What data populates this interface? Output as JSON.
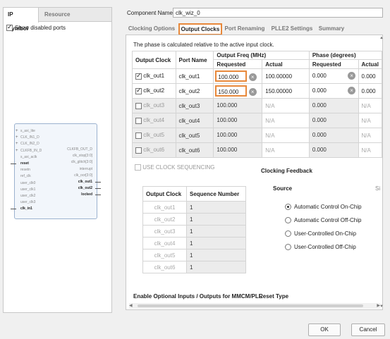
{
  "left_panel": {
    "tabs": [
      "IP Symbol",
      "Resource"
    ],
    "show_disabled_label": "Show disabled ports",
    "left_pins": [
      {
        "name": "s_axi_lite",
        "plus": true,
        "disabled": true
      },
      {
        "name": "CLK_IN1_D",
        "plus": true,
        "disabled": true
      },
      {
        "name": "CLK_IN2_D",
        "plus": true,
        "disabled": true
      },
      {
        "name": "CLKFB_IN_D",
        "plus": true,
        "disabled": true
      },
      {
        "name": "s_axi_aclk",
        "plus": false,
        "disabled": true
      },
      {
        "name": "reset",
        "plus": false,
        "disabled": false
      },
      {
        "name": "resetn",
        "plus": false,
        "disabled": true
      },
      {
        "name": "ref_clk",
        "plus": false,
        "disabled": true
      },
      {
        "name": "user_clk0",
        "plus": false,
        "disabled": true
      },
      {
        "name": "user_clk1",
        "plus": false,
        "disabled": true
      },
      {
        "name": "user_clk2",
        "plus": false,
        "disabled": true
      },
      {
        "name": "user_clk3",
        "plus": false,
        "disabled": true
      },
      {
        "name": "clk_in1",
        "plus": false,
        "disabled": false
      }
    ],
    "left_pins_extra": "s_axi_aresetn",
    "right_pins": [
      {
        "name": "CLKFB_OUT_D",
        "disabled": true
      },
      {
        "name": "clk_stop[3:0]",
        "disabled": true
      },
      {
        "name": "clk_glitch[3:0]",
        "disabled": true
      },
      {
        "name": "interrupt",
        "disabled": true
      },
      {
        "name": "clk_oor[3:0]",
        "disabled": true
      },
      {
        "name": "clk_out1",
        "disabled": false
      },
      {
        "name": "clk_out2",
        "disabled": false
      },
      {
        "name": "locked",
        "disabled": false
      }
    ]
  },
  "component": {
    "label": "Component Name",
    "value": "clk_wiz_0"
  },
  "tabs": [
    "Clocking Options",
    "Output Clocks",
    "Port Renaming",
    "PLLE2 Settings",
    "Summary"
  ],
  "active_tab": "Output Clocks",
  "phase_note": "The phase is calculated relative to the active input clock.",
  "output_table": {
    "headers": {
      "output_clock": "Output Clock",
      "port_name": "Port Name",
      "freq_group": "Output Freq (MHz)",
      "phase_group": "Phase (degrees)",
      "requested": "Requested",
      "actual": "Actual"
    },
    "rows": [
      {
        "enabled": true,
        "clock": "clk_out1",
        "port": "clk_out1",
        "freq_req": "100.000",
        "freq_actual": "100.00000",
        "phase_req": "0.000",
        "phase_actual": "0.000"
      },
      {
        "enabled": true,
        "clock": "clk_out2",
        "port": "clk_out2",
        "freq_req": "150.000",
        "freq_actual": "150.00000",
        "phase_req": "0.000",
        "phase_actual": "0.000"
      },
      {
        "enabled": false,
        "clock": "clk_out3",
        "port": "clk_out3",
        "freq_req": "100.000",
        "freq_actual": "N/A",
        "phase_req": "0.000",
        "phase_actual": "N/A"
      },
      {
        "enabled": false,
        "clock": "clk_out4",
        "port": "clk_out4",
        "freq_req": "100.000",
        "freq_actual": "N/A",
        "phase_req": "0.000",
        "phase_actual": "N/A"
      },
      {
        "enabled": false,
        "clock": "clk_out5",
        "port": "clk_out5",
        "freq_req": "100.000",
        "freq_actual": "N/A",
        "phase_req": "0.000",
        "phase_actual": "N/A"
      },
      {
        "enabled": false,
        "clock": "clk_out6",
        "port": "clk_out6",
        "freq_req": "100.000",
        "freq_actual": "N/A",
        "phase_req": "0.000",
        "phase_actual": "N/A"
      }
    ]
  },
  "sequencing": {
    "label": "USE CLOCK SEQUENCING",
    "headers": [
      "Output Clock",
      "Sequence Number"
    ],
    "rows": [
      {
        "clock": "clk_out1",
        "seq": "1"
      },
      {
        "clock": "clk_out2",
        "seq": "1"
      },
      {
        "clock": "clk_out3",
        "seq": "1"
      },
      {
        "clock": "clk_out4",
        "seq": "1"
      },
      {
        "clock": "clk_out5",
        "seq": "1"
      },
      {
        "clock": "clk_out6",
        "seq": "1"
      }
    ]
  },
  "feedback": {
    "title": "Clocking Feedback",
    "source_label": "Source",
    "truncated_col": "Si",
    "options": [
      {
        "label": "Automatic Control On-Chip",
        "selected": true
      },
      {
        "label": "Automatic Control Off-Chip",
        "selected": false
      },
      {
        "label": "User-Controlled On-Chip",
        "selected": false
      },
      {
        "label": "User-Controlled Off-Chip",
        "selected": false
      }
    ]
  },
  "bottom": {
    "enable_title": "Enable Optional Inputs / Outputs for MMCM/PLL",
    "reset_title": "Reset Type"
  },
  "buttons": {
    "ok": "OK",
    "cancel": "Cancel"
  },
  "colors": {
    "highlight": "#e8883a"
  }
}
